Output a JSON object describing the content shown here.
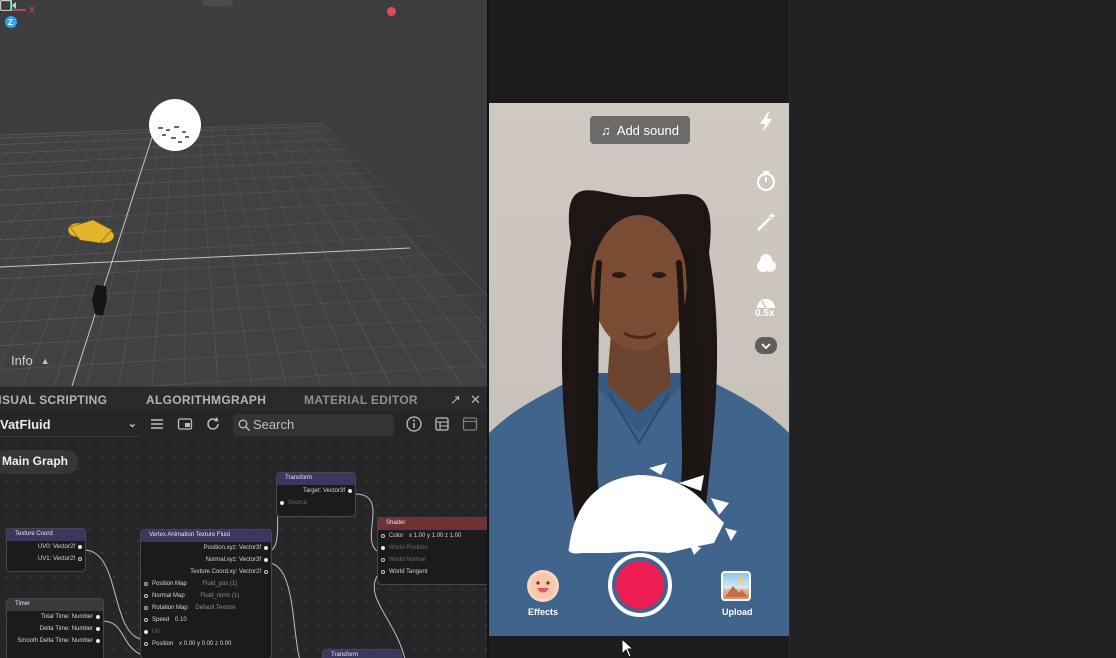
{
  "scene": {
    "info_label": "Info",
    "gizmo": {
      "x_label": "X",
      "z_label": "Z"
    },
    "colors": {
      "record_dot": "#e2495d",
      "grid": "#6a6a6d",
      "gizmo_y": "#2fd1a2",
      "gizmo_z": "#2aa6f2"
    }
  },
  "editor": {
    "tabs": [
      {
        "label": "VISUAL SCRIPTING"
      },
      {
        "label": "ALGORITHMGRAPH"
      },
      {
        "label": "MATERIAL EDITOR"
      }
    ],
    "graph_select": "VatFluid",
    "search_placeholder": "Search",
    "breadcrumb": "Main Graph",
    "nodes": {
      "transform_top": {
        "title": "Transform",
        "outputs": [
          "Target: Vector3f"
        ],
        "inputs": [
          "Source"
        ]
      },
      "texture_coord": {
        "title": "Texture Coord",
        "outputs": [
          "UV0: Vector2f",
          "UV1: Vector2f"
        ]
      },
      "vat_fluid": {
        "title": "Vertex Animation Texture Fluid",
        "outputs": [
          "Position.xyz: Vector3f",
          "Normal.xyz: Vector3f",
          "Texture Coord.xy: Vector2f"
        ],
        "inputs": [
          {
            "label": "Position Map",
            "value": "Fluid_pos (1)"
          },
          {
            "label": "Normal Map",
            "value": "Fluid_norm (1)"
          },
          {
            "label": "Rotation Map",
            "value": "Default Texture"
          },
          {
            "label": "Speed",
            "value": "0.10"
          },
          {
            "label": "UV",
            "value": ""
          },
          {
            "label": "Position",
            "value": "x 0.00   y 0.00   z 0.00"
          }
        ]
      },
      "shader": {
        "title": "Shader",
        "inputs": [
          {
            "label": "Color",
            "value": "x 1.00   y 1.00   z 1.00"
          },
          {
            "label": "World Position",
            "value": ""
          },
          {
            "label": "World Normal",
            "value": ""
          },
          {
            "label": "World Tangent",
            "value": ""
          }
        ]
      },
      "timer": {
        "title": "Timer",
        "outputs": [
          "Total Time: Number",
          "Delta Time: Number",
          "Smooth Delta Time: Number"
        ]
      },
      "transform_bottom": {
        "title": "Transform"
      }
    }
  },
  "preview": {
    "add_sound": "Add sound",
    "speed_label": "0.5x",
    "effects_label": "Effects",
    "upload_label": "Upload",
    "colors": {
      "record": "#ee1d52"
    }
  }
}
